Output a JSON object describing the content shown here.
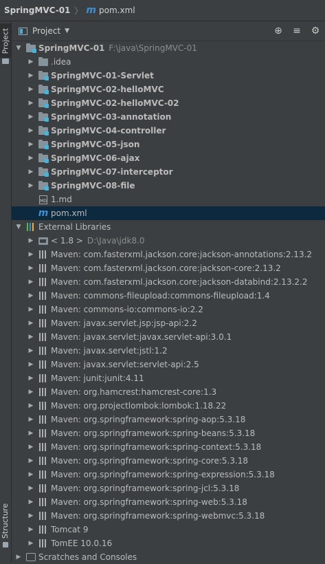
{
  "breadcrumb": {
    "root": "SpringMVC-01",
    "sep": "〉",
    "file": "pom.xml"
  },
  "sidebar": {
    "project_tab": "Project",
    "structure_tab": "Structure"
  },
  "panel": {
    "title": "Project",
    "header_actions": [
      "locate-icon",
      "collapse-icon",
      "settings-icon"
    ]
  },
  "project": {
    "name": "SpringMVC-01",
    "path": "F:\\java\\SpringMVC-01"
  },
  "project_items": [
    {
      "label": ".idea",
      "type": "folder",
      "bold": false
    },
    {
      "label": "SpringMVC-01-Servlet",
      "type": "module",
      "bold": true
    },
    {
      "label": "SpringMVC-02-helloMVC",
      "type": "module",
      "bold": true
    },
    {
      "label": "SpringMVC-02-helloMVC-02",
      "type": "module",
      "bold": true
    },
    {
      "label": "SpringMVC-03-annotation",
      "type": "module",
      "bold": true
    },
    {
      "label": "SpringMVC-04-controller",
      "type": "module",
      "bold": true
    },
    {
      "label": "SpringMVC-05-json",
      "type": "module",
      "bold": true
    },
    {
      "label": "SpringMVC-06-ajax",
      "type": "module",
      "bold": true
    },
    {
      "label": "SpringMVC-07-interceptor",
      "type": "module",
      "bold": true
    },
    {
      "label": "SpringMVC-08-file",
      "type": "module",
      "bold": true
    }
  ],
  "project_files": [
    {
      "label": "1.md",
      "type": "md",
      "selected": false
    },
    {
      "label": "pom.xml",
      "type": "maven",
      "selected": true
    }
  ],
  "external": {
    "label": "External Libraries",
    "jdk": {
      "label": "< 1.8 >",
      "path": "D:\\Java\\jdk8.0"
    },
    "libraries": [
      "Maven: com.fasterxml.jackson.core:jackson-annotations:2.13.2",
      "Maven: com.fasterxml.jackson.core:jackson-core:2.13.2",
      "Maven: com.fasterxml.jackson.core:jackson-databind:2.13.2.2",
      "Maven: commons-fileupload:commons-fileupload:1.4",
      "Maven: commons-io:commons-io:2.2",
      "Maven: javax.servlet.jsp:jsp-api:2.2",
      "Maven: javax.servlet:javax.servlet-api:3.0.1",
      "Maven: javax.servlet:jstl:1.2",
      "Maven: javax.servlet:servlet-api:2.5",
      "Maven: junit:junit:4.11",
      "Maven: org.hamcrest:hamcrest-core:1.3",
      "Maven: org.projectlombok:lombok:1.18.22",
      "Maven: org.springframework:spring-aop:5.3.18",
      "Maven: org.springframework:spring-beans:5.3.18",
      "Maven: org.springframework:spring-context:5.3.18",
      "Maven: org.springframework:spring-core:5.3.18",
      "Maven: org.springframework:spring-expression:5.3.18",
      "Maven: org.springframework:spring-jcl:5.3.18",
      "Maven: org.springframework:spring-web:5.3.18",
      "Maven: org.springframework:spring-webmvc:5.3.18",
      "Tomcat 9",
      "TomEE 10.0.16"
    ]
  },
  "scratches": {
    "label": "Scratches and Consoles"
  }
}
